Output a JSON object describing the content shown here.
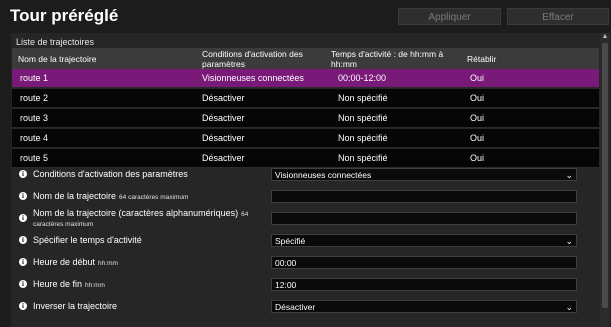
{
  "header": {
    "title": "Tour préréglé",
    "apply_label": "Appliquer",
    "clear_label": "Effacer"
  },
  "list": {
    "title": "Liste de trajectoires",
    "columns": [
      "Nom de la trajectoire",
      "Conditions d'activation des paramètres",
      "Temps d'activité : de hh:mm à hh:mm",
      "Rétablir"
    ],
    "rows": [
      [
        "route 1",
        "Visionneuses connectées",
        "00:00-12:00",
        "Oui"
      ],
      [
        "route 2",
        "Désactiver",
        "Non spécifié",
        "Oui"
      ],
      [
        "route 3",
        "Désactiver",
        "Non spécifié",
        "Oui"
      ],
      [
        "route 4",
        "Désactiver",
        "Non spécifié",
        "Oui"
      ],
      [
        "route 5",
        "Désactiver",
        "Non spécifié",
        "Oui"
      ]
    ],
    "selected_row": 0
  },
  "form": {
    "conditions": {
      "label": "Conditions d'activation des paramètres",
      "value": "Visionneuses connectées"
    },
    "route_name": {
      "label": "Nom de la trajectoire",
      "hint": "64 caractères maximum",
      "value": ""
    },
    "route_name_alnum": {
      "label": "Nom de la trajectoire (caractères alphanumériques)",
      "hint": "64 caractères maximum",
      "value": ""
    },
    "active_time": {
      "label": "Spécifier le temps d'activité",
      "value": "Spécifié"
    },
    "start_time": {
      "label": "Heure de début",
      "hint": "hh:mm",
      "value": "00:00"
    },
    "end_time": {
      "label": "Heure de fin",
      "hint": "hh:mm",
      "value": "12:00"
    },
    "reverse": {
      "label": "Inverser la trajectoire",
      "value": "Désactiver"
    }
  },
  "colors": {
    "background": "#1c1c1c",
    "selected_row": "#7a1a78",
    "table_header": "#3b3b3b"
  },
  "icons": {
    "info": "info-circle-icon",
    "dropdown": "chevron-down-icon",
    "scroll_up": "scroll-up-arrow-icon"
  }
}
